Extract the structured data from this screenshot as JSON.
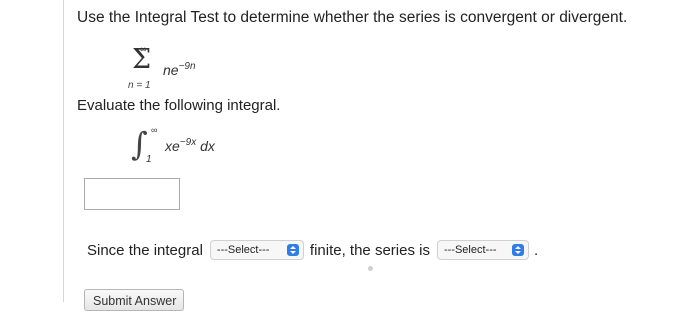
{
  "question": {
    "prompt": "Use the Integral Test to determine whether the series is convergent or divergent."
  },
  "series": {
    "upper": "∞",
    "sigma": "Σ",
    "lower": "n = 1",
    "term_base": "ne",
    "term_exponent": "−9n"
  },
  "evaluate_label": "Evaluate the following integral.",
  "integral": {
    "sign": "∫",
    "upper": "∞",
    "lower": "1",
    "integrand_base": "xe",
    "integrand_exponent": "−9x",
    "differential": " dx"
  },
  "answer_input": {
    "value": ""
  },
  "conclusion": {
    "prefix": "Since the integral",
    "select_1": "---Select---",
    "middle": "finite, the series is",
    "select_2": "---Select---",
    "suffix": "."
  },
  "submit_label": "Submit Answer"
}
